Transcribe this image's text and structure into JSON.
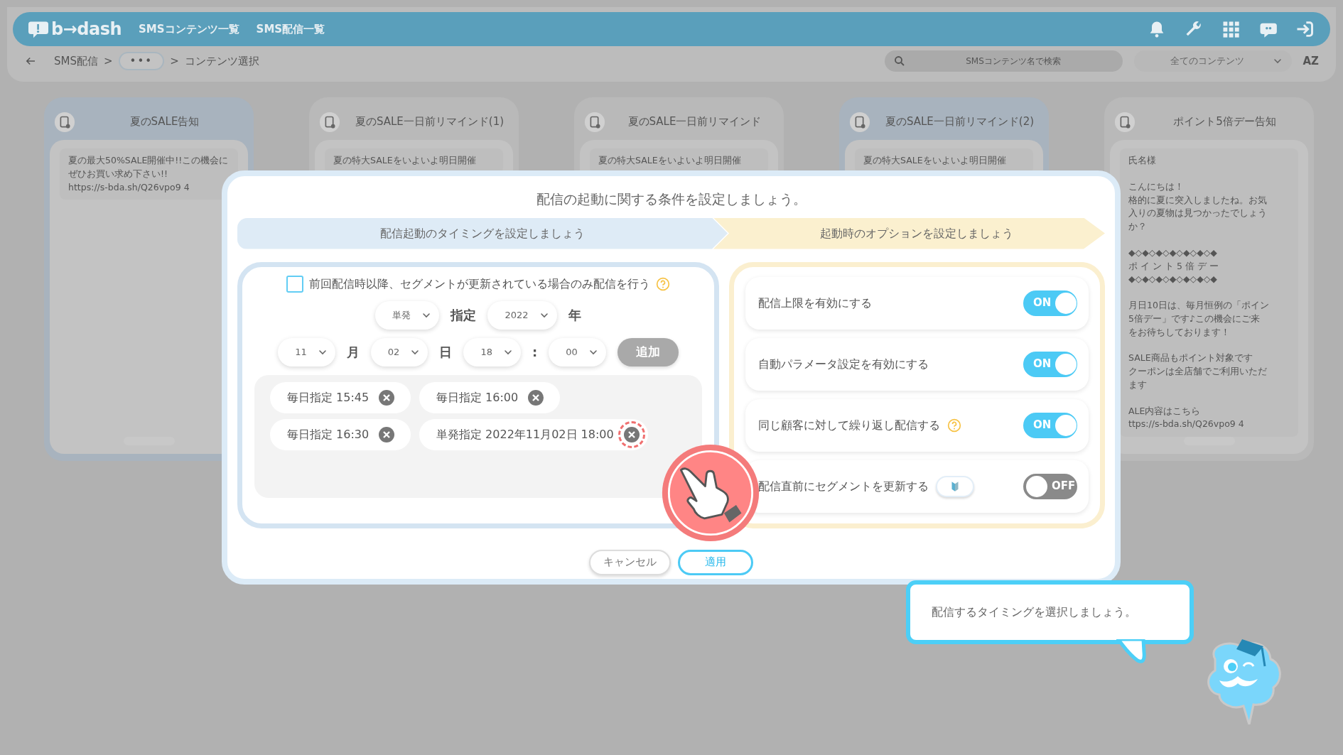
{
  "header": {
    "logo": "b→dash",
    "nav": [
      "SMSコンテンツ一覧",
      "SMS配信一覧"
    ]
  },
  "breadcrumb": [
    {
      "kind": "link",
      "label": "SMS配信"
    },
    {
      "kind": "sep",
      "label": ">"
    },
    {
      "kind": "more",
      "label": "•••"
    },
    {
      "kind": "sep",
      "label": ">"
    },
    {
      "kind": "current",
      "label": "コンテンツ選択"
    }
  ],
  "search": {
    "placeholder": "SMSコンテンツ名で検索"
  },
  "filter": {
    "value": "全てのコンテンツ"
  },
  "sort_label": "AZ",
  "cards": [
    {
      "title": "夏のSALE告知",
      "selected": true,
      "paragraphs": [
        [
          "夏の最大50%SALE開催中!!この機会にぜひお買い求め下さい!!",
          "https://s-bda.sh/Q26vpo9 4"
        ]
      ]
    },
    {
      "title": "夏のSALE一日前リマインド(1)",
      "selected": false,
      "paragraphs": [
        [
          "夏の特大SALEをいよいよ明日開催"
        ]
      ]
    },
    {
      "title": "夏のSALE一日前リマインド",
      "selected": false,
      "paragraphs": [
        [
          "夏の特大SALEをいよいよ明日開催"
        ]
      ]
    },
    {
      "title": "夏のSALE一日前リマインド(2)",
      "selected": true,
      "paragraphs": [
        [
          "夏の特大SALEをいよいよ明日開催"
        ]
      ]
    },
    {
      "title": "ポイント5倍デー告知",
      "selected": false,
      "paragraphs": [
        [
          "氏名様"
        ],
        [
          "こんにちは！",
          "格的に夏に突入しましたね。お気",
          "入りの夏物は見つかったでしょう",
          "か？"
        ],
        [
          "◆◇◆◇◆◇◆◇◆◇◆◇◆",
          "ポ イ ン ト 5 倍 デ ー",
          "◆◇◆◇◆◇◆◇◆◇◆◇◆"
        ],
        [
          "月日10日は、毎月恒例の「ポイン",
          "5倍デー」です♪この機会にご来",
          "をお待ちしております！"
        ],
        [
          "SALE商品もポイント対象です",
          "クーポンは全店舗でご利用いただ",
          "ます"
        ],
        [
          "ALE内容はこちら",
          "ttps://s-bda.sh/Q26vpo9 4"
        ]
      ]
    }
  ],
  "modal": {
    "title": "配信の起動に関する条件を設定しましょう。",
    "steps": [
      {
        "label": "配信起動のタイミングを設定しましょう",
        "color": "#deebf6"
      },
      {
        "label": "起動時のオプションを設定しましょう",
        "color": "#fbf0cf"
      }
    ],
    "segment_check": {
      "label": "前回配信時以降、セグメントが更新されている場合のみ配信を行う",
      "checked": false
    },
    "row1": [
      {
        "kind": "select",
        "value": "単発"
      },
      {
        "kind": "label",
        "label": "指定"
      },
      {
        "kind": "select",
        "value": "2022"
      },
      {
        "kind": "label",
        "label": "年"
      }
    ],
    "row2": [
      {
        "kind": "select",
        "value": "11"
      },
      {
        "kind": "label",
        "label": "月"
      },
      {
        "kind": "select",
        "value": "02"
      },
      {
        "kind": "label",
        "label": "日"
      },
      {
        "kind": "select",
        "value": "18"
      },
      {
        "kind": "label",
        "label": ":"
      },
      {
        "kind": "select",
        "value": "00"
      },
      {
        "kind": "button",
        "label": "追加",
        "disabled": true
      }
    ],
    "schedules": [
      {
        "label": "毎日指定 15:45",
        "highlighted": false
      },
      {
        "label": "毎日指定 16:00",
        "highlighted": false
      },
      {
        "label": "毎日指定 16:30",
        "highlighted": false
      },
      {
        "label": "単発指定 2022年11月02日 18:00",
        "highlighted": true
      }
    ],
    "options": [
      {
        "label": "配信上限を有効にする",
        "help": false,
        "beginner": false,
        "on": true,
        "toggle_text": "ON"
      },
      {
        "label": "自動パラメータ設定を有効にする",
        "help": false,
        "beginner": false,
        "on": true,
        "toggle_text": "ON"
      },
      {
        "label": "同じ顧客に対して繰り返し配信する",
        "help": true,
        "beginner": false,
        "on": true,
        "toggle_text": "ON"
      },
      {
        "label": "配信直前にセグメントを更新する",
        "help": false,
        "beginner": true,
        "on": false,
        "toggle_text": "OFF"
      }
    ],
    "buttons": [
      {
        "kind": "cancel",
        "label": "キャンセル"
      },
      {
        "kind": "apply",
        "label": "適用"
      }
    ]
  },
  "tip": {
    "text": "配信するタイミングを選択しましょう。"
  }
}
